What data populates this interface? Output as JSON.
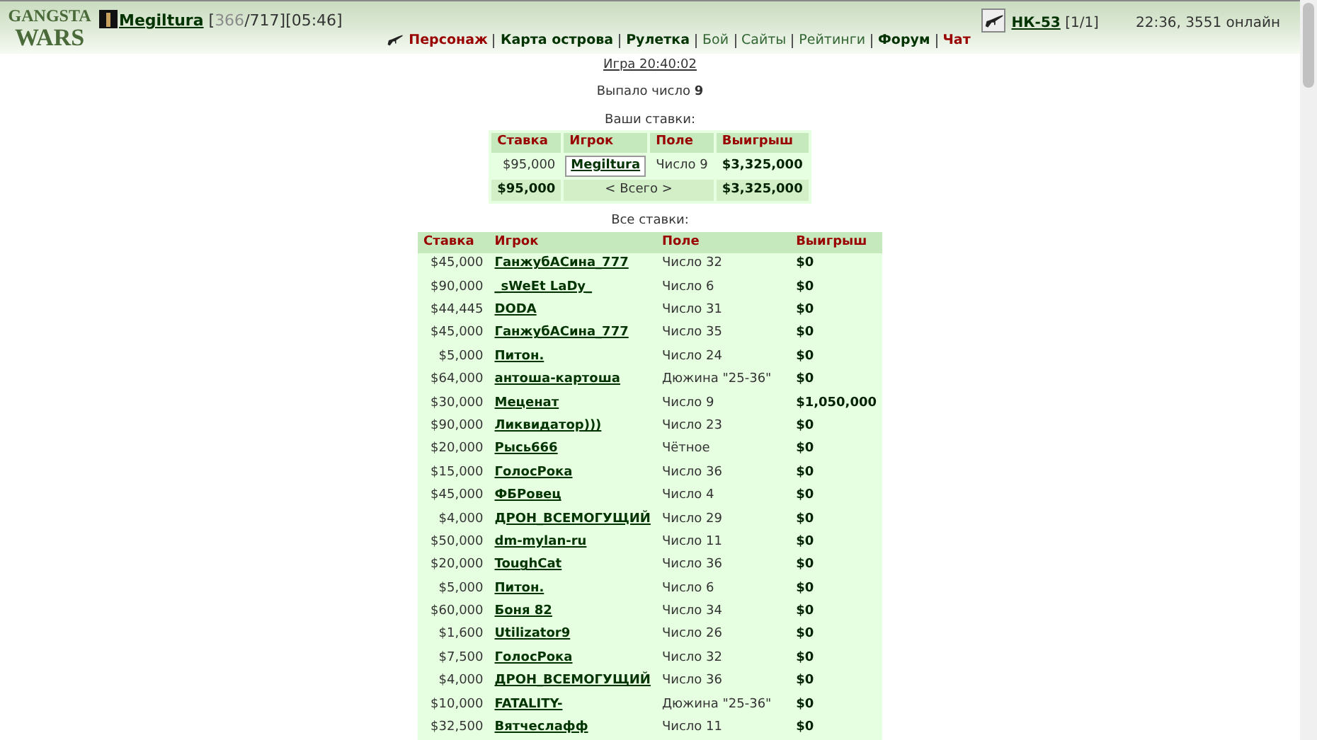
{
  "header": {
    "logo_top": "GANGSTA",
    "logo_bottom": "WARS",
    "user": {
      "name": "Megiltura",
      "hp_current": "366",
      "hp_rest": "/717]",
      "bracket_open": "[",
      "time": "[05:46]"
    },
    "weapon": {
      "name": "НК-53",
      "count": "[1/1]"
    },
    "status": "22:36, 3551 онлайн"
  },
  "nav": [
    {
      "label": "Персонаж",
      "kind": "red",
      "icon": true
    },
    {
      "label": "Карта острова",
      "kind": "bold",
      "icon": false
    },
    {
      "label": "Рулетка",
      "kind": "bold",
      "icon": false
    },
    {
      "label": "Бой",
      "kind": "plain",
      "icon": false
    },
    {
      "label": "Сайты",
      "kind": "plain",
      "icon": false
    },
    {
      "label": "Рейтинги",
      "kind": "plain",
      "icon": false
    },
    {
      "label": "Форум",
      "kind": "bold",
      "icon": false
    },
    {
      "label": "Чат",
      "kind": "red",
      "icon": false
    }
  ],
  "game_link": "Игра 20:40:02",
  "result": {
    "text": "Выпало число",
    "number": "9"
  },
  "your_bets": {
    "title": "Ваши ставки:",
    "columns": [
      "Ставка",
      "Игрок",
      "Поле",
      "Выигрыш"
    ],
    "rows": [
      {
        "bet": "$95,000",
        "player": "Megiltura",
        "field": "Число 9",
        "win": "$3,325,000"
      }
    ],
    "total": {
      "bet": "$95,000",
      "label": "< Всего >",
      "win": "$3,325,000"
    }
  },
  "all_bets": {
    "title": "Все ставки:",
    "columns": [
      "Ставка",
      "Игрок",
      "Поле",
      "Выигрыш"
    ],
    "rows": [
      {
        "bet": "$45,000",
        "player": "ГанжубАСина_777",
        "field": "Число 32",
        "win": "$0"
      },
      {
        "bet": "$90,000",
        "player": "_sWeEt LaDy_",
        "field": "Число 6",
        "win": "$0"
      },
      {
        "bet": "$44,445",
        "player": "DODA",
        "field": "Число 31",
        "win": "$0"
      },
      {
        "bet": "$45,000",
        "player": "ГанжубАСина_777",
        "field": "Число 35",
        "win": "$0"
      },
      {
        "bet": "$5,000",
        "player": "Питон.",
        "field": "Число 24",
        "win": "$0"
      },
      {
        "bet": "$64,000",
        "player": "антоша-картоша",
        "field": "Дюжина \"25-36\"",
        "win": "$0"
      },
      {
        "bet": "$30,000",
        "player": "Меценат",
        "field": "Число 9",
        "win": "$1,050,000"
      },
      {
        "bet": "$90,000",
        "player": "Ликвидатор)))",
        "field": "Число 23",
        "win": "$0"
      },
      {
        "bet": "$20,000",
        "player": "Рысь666",
        "field": "Чётное",
        "win": "$0"
      },
      {
        "bet": "$15,000",
        "player": "ГолосРока",
        "field": "Число 36",
        "win": "$0"
      },
      {
        "bet": "$45,000",
        "player": "ФБРовец",
        "field": "Число 4",
        "win": "$0"
      },
      {
        "bet": "$4,000",
        "player": "ДРОН_ВСЕМОГУЩИЙ",
        "field": "Число 29",
        "win": "$0"
      },
      {
        "bet": "$50,000",
        "player": "dm-mylan-ru",
        "field": "Число 11",
        "win": "$0"
      },
      {
        "bet": "$20,000",
        "player": "ToughCat",
        "field": "Число 36",
        "win": "$0"
      },
      {
        "bet": "$5,000",
        "player": "Питон.",
        "field": "Число 6",
        "win": "$0"
      },
      {
        "bet": "$60,000",
        "player": "Боня 82",
        "field": "Число 34",
        "win": "$0"
      },
      {
        "bet": "$1,600",
        "player": "Utilizator9",
        "field": "Число 26",
        "win": "$0"
      },
      {
        "bet": "$7,500",
        "player": "ГолосРока",
        "field": "Число 32",
        "win": "$0"
      },
      {
        "bet": "$4,000",
        "player": "ДРОН_ВСЕМОГУЩИЙ",
        "field": "Число 36",
        "win": "$0"
      },
      {
        "bet": "$10,000",
        "player": "FATALITY-",
        "field": "Дюжина \"25-36\"",
        "win": "$0"
      },
      {
        "bet": "$32,500",
        "player": "Вятчеслафф",
        "field": "Число 11",
        "win": "$0"
      }
    ]
  }
}
